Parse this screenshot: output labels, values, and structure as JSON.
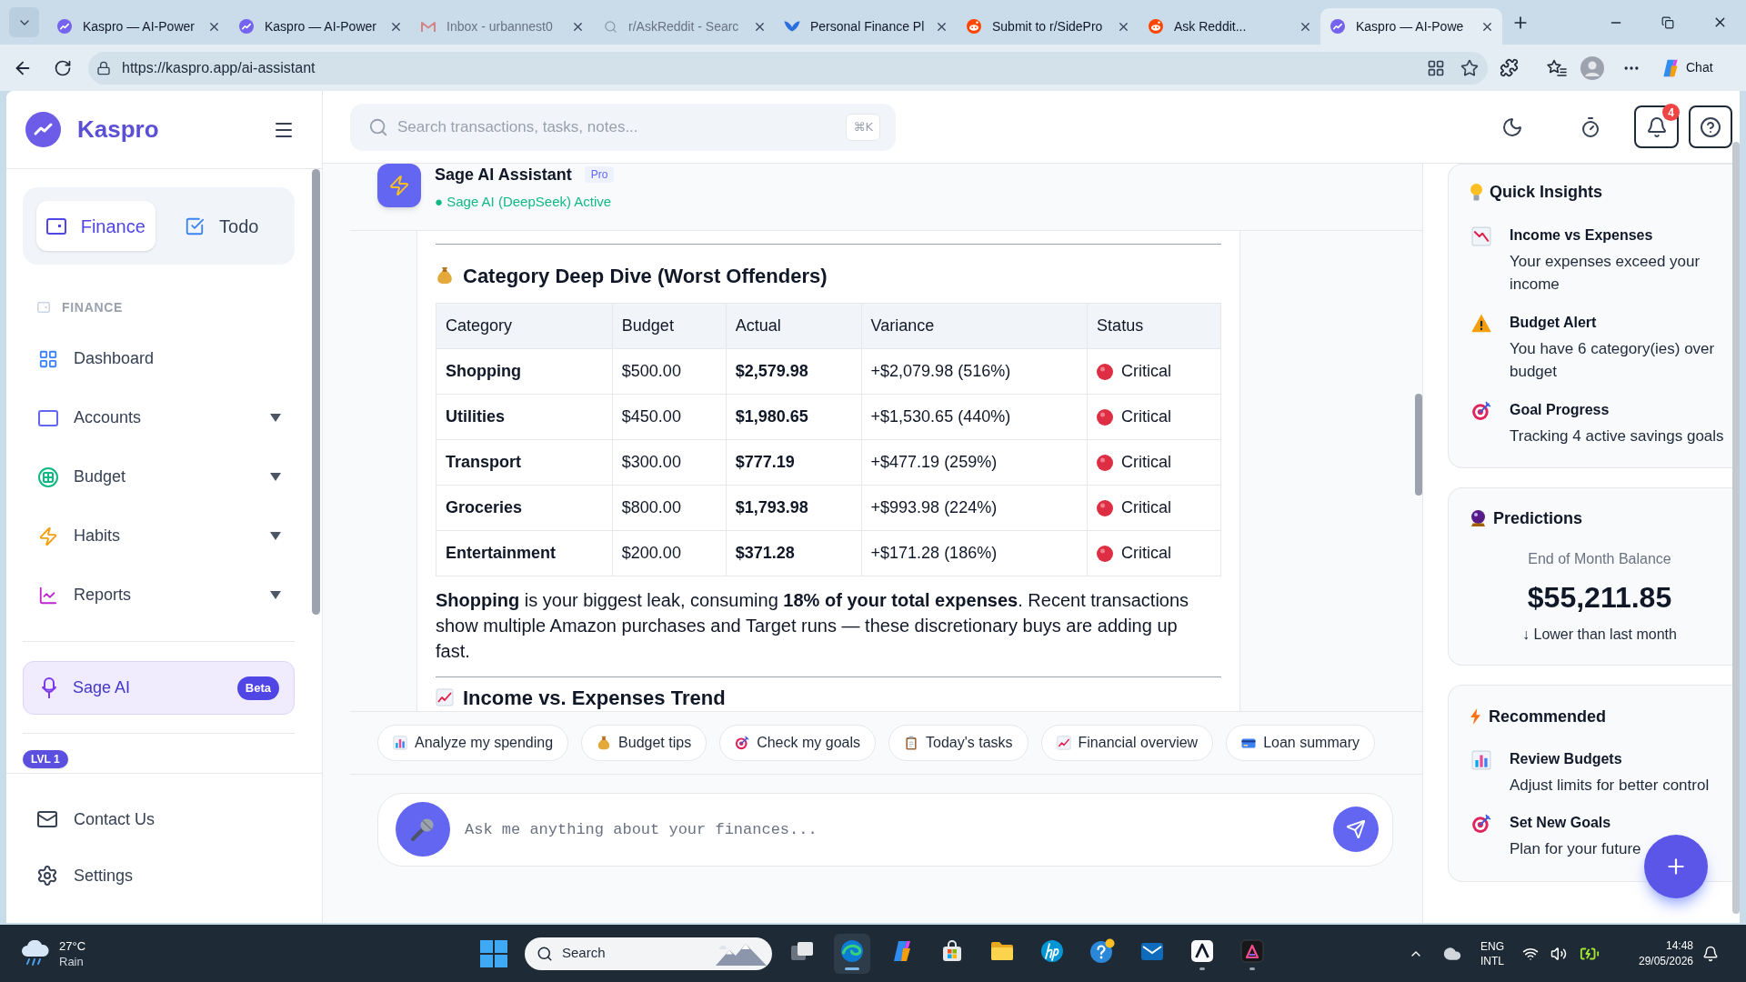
{
  "browser": {
    "tabs": [
      {
        "title": "Kaspro — AI-Power",
        "kind": "kaspro",
        "selected": false,
        "dimmed": false
      },
      {
        "title": "Kaspro — AI-Power",
        "kind": "kaspro",
        "selected": false,
        "dimmed": false
      },
      {
        "title": "Inbox - urbannest0",
        "kind": "mail",
        "selected": false,
        "dimmed": true
      },
      {
        "title": "r/AskReddit - Searc",
        "kind": "search",
        "selected": false,
        "dimmed": true
      },
      {
        "title": "Personal Finance Pl",
        "kind": "bird",
        "selected": false,
        "dimmed": false
      },
      {
        "title": "Submit to r/SidePro",
        "kind": "reddit",
        "selected": false,
        "dimmed": false
      },
      {
        "title": "Ask Reddit...",
        "kind": "reddit",
        "selected": false,
        "dimmed": false
      },
      {
        "title": "Kaspro — AI-Powe",
        "kind": "kaspro",
        "selected": true,
        "dimmed": false
      }
    ],
    "url": "https://kaspro.app/ai-assistant",
    "chat_label": "Chat"
  },
  "sidebar": {
    "brand": "Kaspro",
    "modes": [
      {
        "label": "Finance",
        "kind": "wallet",
        "selected": true
      },
      {
        "label": "Todo",
        "kind": "check",
        "selected": false
      }
    ],
    "section": "FINANCE",
    "items": [
      {
        "label": "Dashboard",
        "kind": "grid",
        "expandable": false,
        "selected": false
      },
      {
        "label": "Accounts",
        "kind": "card",
        "expandable": true,
        "selected": false
      },
      {
        "label": "Budget",
        "kind": "budget",
        "expandable": true,
        "selected": false
      },
      {
        "label": "Habits",
        "kind": "bolt",
        "expandable": true,
        "selected": false
      },
      {
        "label": "Reports",
        "kind": "chart",
        "expandable": true,
        "selected": false
      }
    ],
    "assistant_link": {
      "label": "Sage AI",
      "badge": "Beta",
      "selected": true
    },
    "level_badge": "LVL 1",
    "footer": [
      {
        "label": "Contact Us",
        "kind": "mail"
      },
      {
        "label": "Settings",
        "kind": "gear"
      }
    ]
  },
  "topbar": {
    "search": {
      "placeholder": "Search transactions, tasks, notes...",
      "shortcut": "⌘K"
    },
    "notification_count": "4"
  },
  "chat": {
    "title": "Sage AI Assistant",
    "badge": "Pro",
    "status": "● Sage AI (DeepSeek) Active",
    "message": {
      "heading": "Category Deep Dive (Worst Offenders)",
      "table": {
        "columns": [
          "Category",
          "Budget",
          "Actual",
          "Variance",
          "Status"
        ],
        "rows": [
          {
            "category": "Shopping",
            "budget": "$500.00",
            "actual": "$2,579.98",
            "variance": "+$2,079.98 (516%)",
            "status": "Critical"
          },
          {
            "category": "Utilities",
            "budget": "$450.00",
            "actual": "$1,980.65",
            "variance": "+$1,530.65 (440%)",
            "status": "Critical"
          },
          {
            "category": "Transport",
            "budget": "$300.00",
            "actual": "$777.19",
            "variance": "+$477.19 (259%)",
            "status": "Critical"
          },
          {
            "category": "Groceries",
            "budget": "$800.00",
            "actual": "$1,793.98",
            "variance": "+$993.98 (224%)",
            "status": "Critical"
          },
          {
            "category": "Entertainment",
            "budget": "$200.00",
            "actual": "$371.28",
            "variance": "+$171.28 (186%)",
            "status": "Critical"
          }
        ]
      },
      "summary": "**Shopping** is your biggest leak, consuming **18% of your total expenses**. Recent transactions show multiple Amazon purchases and Target runs — these discretionary buys are adding up fast.",
      "next_heading": "Income vs. Expenses Trend"
    },
    "suggestions": [
      {
        "label": "Analyze my spending",
        "kind": "bar-chart"
      },
      {
        "label": "Budget tips",
        "kind": "money-bag"
      },
      {
        "label": "Check my goals",
        "kind": "target"
      },
      {
        "label": "Today's tasks",
        "kind": "clipboard"
      },
      {
        "label": "Financial overview",
        "kind": "chart-up"
      },
      {
        "label": "Loan summary",
        "kind": "card"
      }
    ],
    "input": {
      "placeholder": "Ask me anything about your finances..."
    }
  },
  "insights": {
    "title": "Quick Insights",
    "items": [
      {
        "kind": "chart-down",
        "title": "Income vs Expenses",
        "text": "Your expenses exceed your income"
      },
      {
        "kind": "warning",
        "title": "Budget Alert",
        "text": "You have 6 category(ies) over budget"
      },
      {
        "kind": "target",
        "title": "Goal Progress",
        "text": "Tracking 4 active savings goals"
      }
    ]
  },
  "predictions": {
    "title": "Predictions",
    "label": "End of Month Balance",
    "value": "$55,211.85",
    "trend": "↓ Lower than last month"
  },
  "recommended": {
    "title": "Recommended",
    "items": [
      {
        "kind": "bar-chart",
        "title": "Review Budgets",
        "text": "Adjust limits for better control"
      },
      {
        "kind": "target",
        "title": "Set New Goals",
        "text": "Plan for your future"
      }
    ]
  },
  "taskbar": {
    "weather": {
      "temperature": "27°C",
      "condition": "Rain"
    },
    "search": "Search",
    "apps": [
      {
        "kind": "task-view",
        "selected": false,
        "running": false
      },
      {
        "kind": "edge",
        "selected": true,
        "running": true
      },
      {
        "kind": "copilot",
        "selected": false,
        "running": false
      },
      {
        "kind": "store",
        "selected": false,
        "running": false
      },
      {
        "kind": "files",
        "selected": false,
        "running": false
      },
      {
        "kind": "hp",
        "selected": false,
        "running": false
      },
      {
        "kind": "help",
        "selected": false,
        "running": false
      },
      {
        "kind": "outlook",
        "selected": false,
        "running": false
      },
      {
        "kind": "a-app",
        "selected": false,
        "running": true
      },
      {
        "kind": "adobe",
        "selected": false,
        "running": true
      }
    ],
    "language": [
      "ENG",
      "INTL"
    ],
    "time": "14:48",
    "date": "29/05/2026"
  }
}
